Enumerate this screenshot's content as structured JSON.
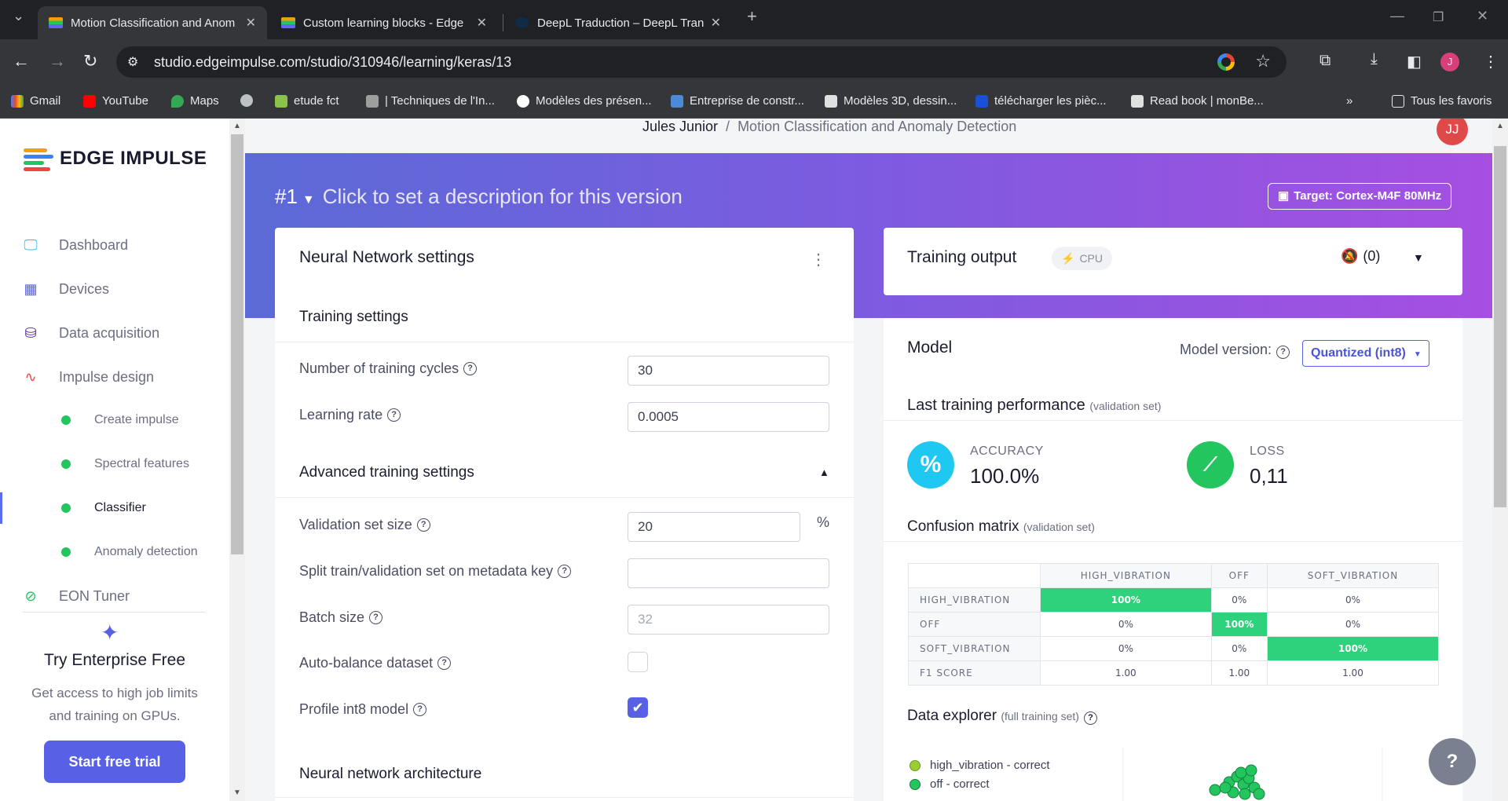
{
  "browser": {
    "tabs": [
      {
        "title": "Motion Classification and Anom",
        "active": true
      },
      {
        "title": "Custom learning blocks - Edge",
        "active": false
      },
      {
        "title": "DeepL Traduction – DeepL Tran",
        "active": false
      }
    ],
    "url": "studio.edgeimpulse.com/studio/310946/learning/keras/13",
    "profile_initial": "J",
    "bookmarks": [
      "Gmail",
      "YouTube",
      "Maps",
      "etude fct",
      "| Techniques de l'In...",
      "Modèles des présen...",
      "Entreprise de constr...",
      "Modèles 3D, dessin...",
      "télécharger les pièc...",
      "Read book | monBe..."
    ],
    "bookmarks_overflow": "»",
    "all_bookmarks": "Tous les favoris"
  },
  "sidebar": {
    "logo": "EDGE IMPULSE",
    "items": [
      {
        "label": "Dashboard",
        "icon": "monitor-icon"
      },
      {
        "label": "Devices",
        "icon": "chip-icon"
      },
      {
        "label": "Data acquisition",
        "icon": "database-icon"
      },
      {
        "label": "Impulse design",
        "icon": "pulse-icon"
      }
    ],
    "subitems": [
      "Create impulse",
      "Spectral features",
      "Classifier",
      "Anomaly detection"
    ],
    "eon": "EON Tuner",
    "enterprise_title": "Try Enterprise Free",
    "enterprise_text": "Get access to high job limits and training on GPUs.",
    "trial_button": "Start free trial"
  },
  "header": {
    "user": "Jules Junior",
    "project": "Motion Classification and Anomaly Detection",
    "avatar": "JJ",
    "version": "#1",
    "version_desc": "Click to set a description for this version",
    "target": "Target: Cortex-M4F 80MHz"
  },
  "nn_settings": {
    "title": "Neural Network settings",
    "training_settings": "Training settings",
    "cycles_label": "Number of training cycles",
    "cycles_value": "30",
    "lr_label": "Learning rate",
    "lr_value": "0.0005",
    "advanced": "Advanced training settings",
    "val_label": "Validation set size",
    "val_value": "20",
    "val_unit": "%",
    "split_label": "Split train/validation set on metadata key",
    "split_value": "",
    "batch_label": "Batch size",
    "batch_placeholder": "32",
    "autobalance_label": "Auto-balance dataset",
    "autobalance": false,
    "profile_label": "Profile int8 model",
    "profile": true,
    "arch": "Neural network architecture"
  },
  "training_output": {
    "title": "Training output",
    "device": "CPU",
    "notifications": "(0)"
  },
  "model": {
    "title": "Model",
    "version_label": "Model version:",
    "version_value": "Quantized (int8)",
    "perf_title": "Last training performance",
    "perf_sub": "(validation set)",
    "accuracy_label": "ACCURACY",
    "accuracy_value": "100.0%",
    "loss_label": "LOSS",
    "loss_value": "0,11",
    "cm_title": "Confusion matrix",
    "cm_sub": "(validation set)",
    "cm_columns": [
      "HIGH_VIBRATION",
      "OFF",
      "SOFT_VIBRATION"
    ],
    "cm_rows": [
      {
        "label": "HIGH_VIBRATION",
        "values": [
          "100%",
          "0%",
          "0%"
        ]
      },
      {
        "label": "OFF",
        "values": [
          "0%",
          "100%",
          "0%"
        ]
      },
      {
        "label": "SOFT_VIBRATION",
        "values": [
          "0%",
          "0%",
          "100%"
        ]
      },
      {
        "label": "F1 SCORE",
        "values": [
          "1.00",
          "1.00",
          "1.00"
        ]
      }
    ],
    "explorer_title": "Data explorer",
    "explorer_sub": "(full training set)",
    "legend": [
      "high_vibration - correct",
      "off - correct"
    ]
  },
  "colors": {
    "accent": "#5861e6",
    "success": "#2ed17c",
    "accuracy": "#1ec8f0"
  }
}
